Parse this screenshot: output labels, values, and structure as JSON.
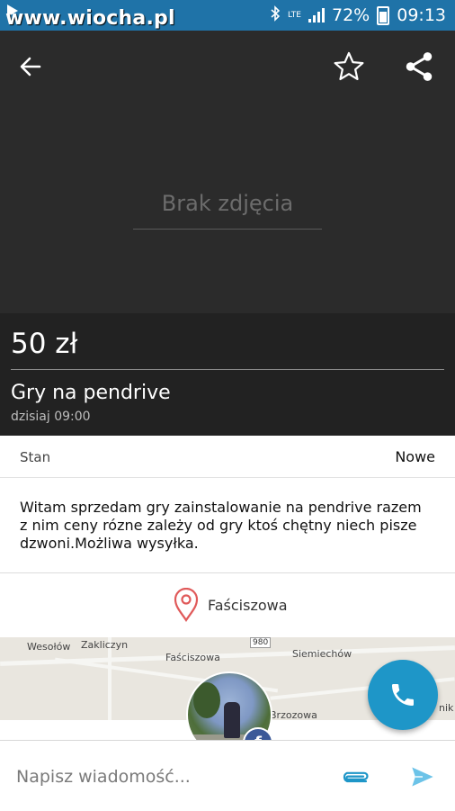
{
  "status_bar": {
    "watermark": "www.wiocha.pl",
    "network": "LTE",
    "battery": "72%",
    "time": "09:13"
  },
  "listing": {
    "no_photo_text": "Brak zdjęcia",
    "price": "50 zł",
    "title": "Gry na pendrive",
    "date": "dzisiaj 09:00",
    "condition_label": "Stan",
    "condition_value": "Nowe",
    "description": "Witam sprzedam gry zainstalowanie na pendrive razem\nz nim ceny rózne zależy od gry ktoś chętny niech pisze\ndzwoni.Możliwa wysyłka.",
    "location": "Faściszowa"
  },
  "map": {
    "labels": {
      "wesolow": "Wesołów",
      "zakliczyn": "Zakliczyn",
      "fasciszowa": "Faściszowa",
      "siemiechow": "Siemiechów",
      "brzozowa": "Brzozowa",
      "nik": "nik",
      "road": "980"
    }
  },
  "compose": {
    "placeholder": "Napisz wiadomość..."
  },
  "colors": {
    "status_bar": "#1f73a8",
    "photo_bg": "#2b2b2b",
    "price_bg": "#222222",
    "accent": "#1e96c8",
    "pin": "#e05a5a"
  }
}
